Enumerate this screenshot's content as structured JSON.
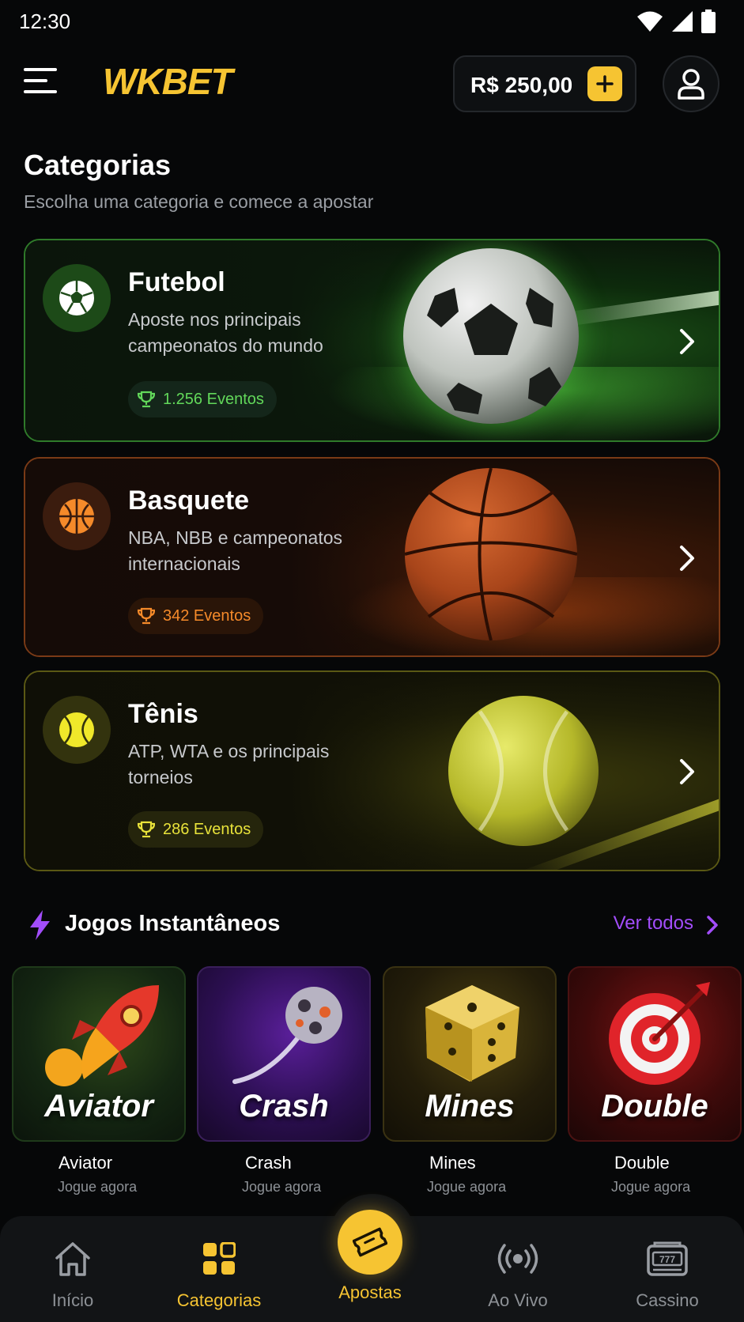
{
  "status_bar": {
    "time": "12:30"
  },
  "header": {
    "logo": "WKBET",
    "balance": "R$ 250,00"
  },
  "categories": {
    "title": "Categorias",
    "subtitle": "Escolha uma categoria e comece a apostar",
    "items": [
      {
        "name": "Futebol",
        "description": "Aposte nos principais campeonatos do mundo",
        "events": "1.256 Eventos",
        "accent": "#4fd04a"
      },
      {
        "name": "Basquete",
        "description": "NBA, NBB e campeonatos internacionais",
        "events": "342 Eventos",
        "accent": "#f58a2a"
      },
      {
        "name": "Tênis",
        "description": "ATP, WTA e os principais torneios",
        "events": "286 Eventos",
        "accent": "#e4e23a"
      }
    ]
  },
  "instant_games": {
    "title": "Jogos Instantâneos",
    "see_all": "Ver todos",
    "items": [
      {
        "tile": "Aviator",
        "name": "Aviator",
        "cta": "Jogue agora"
      },
      {
        "tile": "Crash",
        "name": "Crash",
        "cta": "Jogue agora"
      },
      {
        "tile": "Mines",
        "name": "Mines",
        "cta": "Jogue agora"
      },
      {
        "tile": "Double",
        "name": "Double",
        "cta": "Jogue agora"
      }
    ]
  },
  "bottom_nav": {
    "items": [
      {
        "label": "Início",
        "icon": "home-icon"
      },
      {
        "label": "Categorias",
        "icon": "grid-icon"
      },
      {
        "label": "Apostas",
        "icon": "ticket-icon"
      },
      {
        "label": "Ao Vivo",
        "icon": "live-icon"
      },
      {
        "label": "Cassino",
        "icon": "slot-machine-icon"
      }
    ],
    "active": "Categorias"
  },
  "colors": {
    "brand": "#f6c432",
    "link": "#a24dfa",
    "background": "#060708"
  }
}
